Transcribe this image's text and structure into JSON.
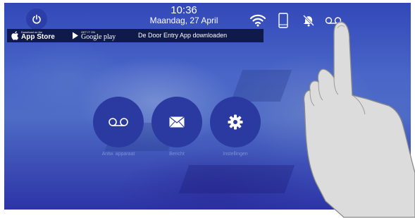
{
  "header": {
    "time": "10:36",
    "date": "Maandag, 27 April"
  },
  "store_bar": {
    "appstore_small": "Download on the",
    "appstore_big": "App Store",
    "googleplay_small": "GET IT ON",
    "googleplay_big": "Google play",
    "text": "De Door Entry App downloaden"
  },
  "status_icons": [
    "wifi-icon",
    "smartphone-icon",
    "bell-muted-icon",
    "voicemail-icon"
  ],
  "buttons": [
    {
      "label": "Antw. apparaat",
      "icon": "voicemail-icon"
    },
    {
      "label": "Bericht",
      "icon": "envelope-icon"
    },
    {
      "label": "Instellingen",
      "icon": "gear-icon"
    }
  ],
  "colors": {
    "accent": "#2a3aa0",
    "label": "#7d90d8"
  }
}
